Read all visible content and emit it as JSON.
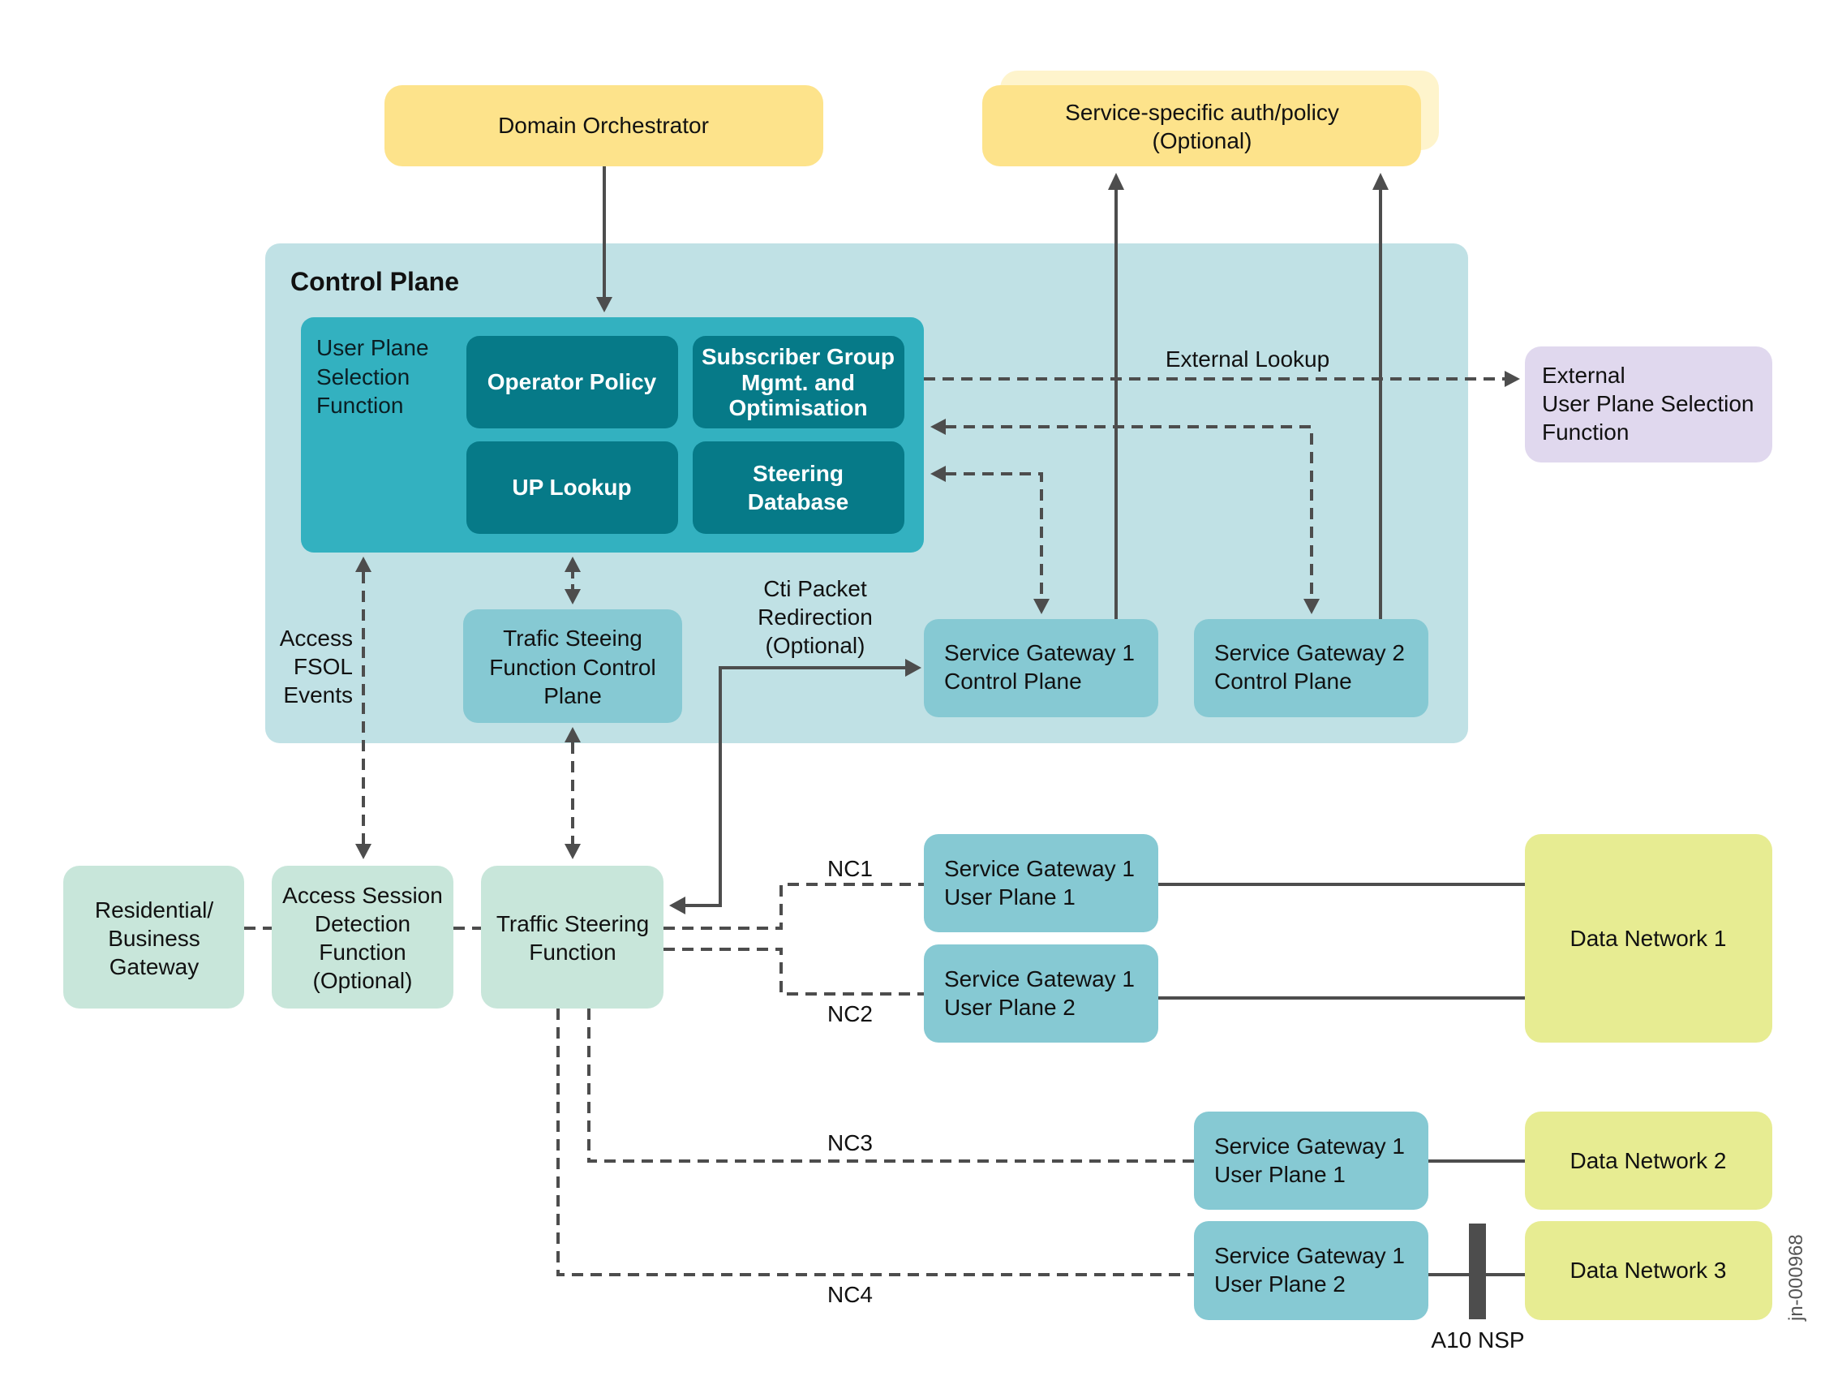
{
  "colors": {
    "yellow": "#fde38b",
    "yellow_back": "#fef4cc",
    "control_plane_bg": "#c0e1e5",
    "uspf_bg": "#33b1c0",
    "uspf_inner": "#067a88",
    "teal_box": "#86c9d3",
    "mint_box": "#c8e6da",
    "purple_box": "#e0d8ee",
    "lime_box": "#e7ec92",
    "line": "#4d4d4d"
  },
  "top": {
    "domain_orchestrator": "Domain Orchestrator",
    "service_auth": [
      "Service-specific auth/policy",
      "(Optional)"
    ]
  },
  "control_plane": {
    "title": "Control Plane",
    "uspf": {
      "label": [
        "User Plane",
        "Selection",
        "Function"
      ],
      "operator_policy": "Operator Policy",
      "subscriber_group": [
        "Subscriber Group",
        "Mgmt. and",
        "Optimisation"
      ],
      "up_lookup": "UP Lookup",
      "steering_db": [
        "Steering",
        "Database"
      ]
    },
    "tsf_cp": [
      "Trafic Steeing",
      "Function Control",
      "Plane"
    ],
    "sg1_cp": [
      "Service Gateway 1",
      "Control Plane"
    ],
    "sg2_cp": [
      "Service Gateway 2",
      "Control Plane"
    ],
    "access_events": [
      "Access",
      "FSOL",
      "Events"
    ],
    "cti_label": [
      "Cti Packet",
      "Redirection",
      "(Optional)"
    ]
  },
  "external": {
    "lookup_label": "External Lookup",
    "uspf": [
      "External",
      "User Plane Selection",
      "Function"
    ]
  },
  "access": {
    "residential": [
      "Residential/",
      "Business",
      "Gateway"
    ],
    "asdf": [
      "Access Session",
      "Detection",
      "Function",
      "(Optional)"
    ],
    "tsf": [
      "Traffic Steering",
      "Function"
    ]
  },
  "user_planes": {
    "a_up1": [
      "Service Gateway 1",
      "User Plane 1"
    ],
    "a_up2": [
      "Service Gateway 1",
      "User Plane 2"
    ],
    "b_up1": [
      "Service Gateway 1",
      "User Plane 1"
    ],
    "b_up2": [
      "Service Gateway 1",
      "User Plane 2"
    ]
  },
  "connections": {
    "nc1": "NC1",
    "nc2": "NC2",
    "nc3": "NC3",
    "nc4": "NC4"
  },
  "data_networks": {
    "dn1": "Data Network 1",
    "dn2": "Data Network 2",
    "dn3": "Data Network 3"
  },
  "a10_label": "A10 NSP",
  "figure_id": "jn-000968"
}
